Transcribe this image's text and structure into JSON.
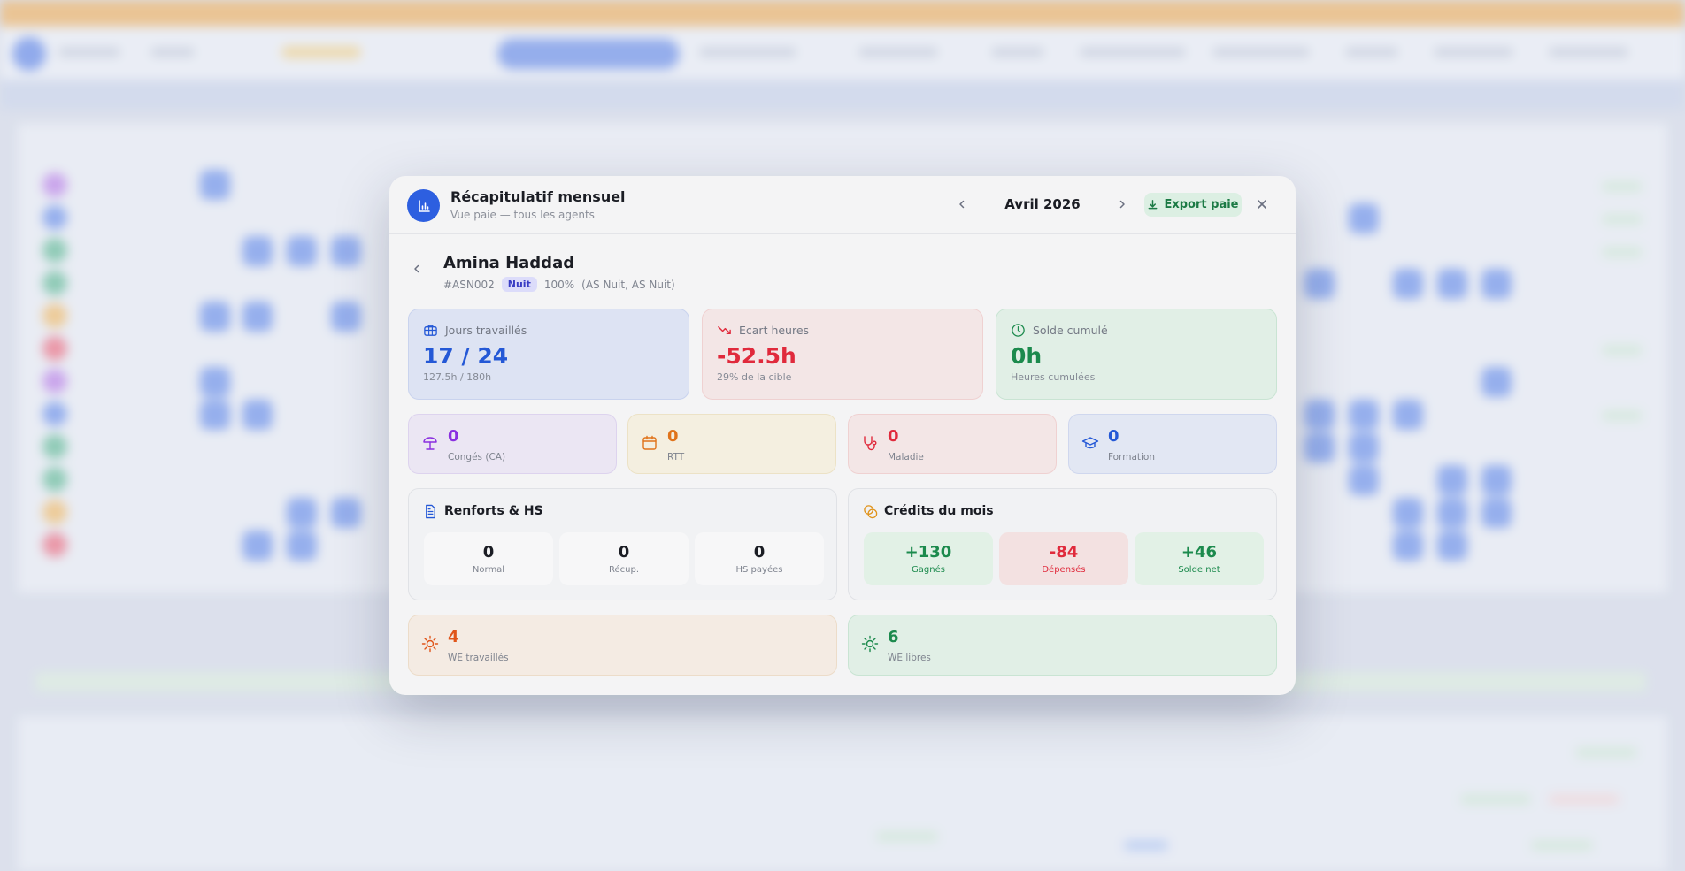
{
  "modal": {
    "title": "Récapitulatif mensuel",
    "subtitle": "Vue paie — tous les agents",
    "month": "Avril 2026",
    "export_label": "Export paie"
  },
  "agent": {
    "name": "Amina Haddad",
    "id": "#ASN002",
    "shift_badge": "Nuit",
    "rate": "100%",
    "roles": "(AS Nuit, AS Nuit)"
  },
  "stats": {
    "days": {
      "label": "Jours travaillés",
      "value": "17 / 24",
      "sub": "127.5h / 180h",
      "color": "#2458d6"
    },
    "gap": {
      "label": "Ecart heures",
      "value": "-52.5h",
      "sub": "29% de la cible",
      "color": "#e02a3c"
    },
    "balance": {
      "label": "Solde cumulé",
      "value": "0h",
      "sub": "Heures cumulées",
      "color": "#1c8a4d"
    }
  },
  "absences": [
    {
      "value": "0",
      "label": "Congés (CA)",
      "icon": "umbrella-beach-icon",
      "color": "#8a2fe0"
    },
    {
      "value": "0",
      "label": "RTT",
      "icon": "calendar-icon",
      "color": "#e0731a"
    },
    {
      "value": "0",
      "label": "Maladie",
      "icon": "stethoscope-icon",
      "color": "#e02a3c"
    },
    {
      "value": "0",
      "label": "Formation",
      "icon": "graduation-cap-icon",
      "color": "#2458d6"
    }
  ],
  "renforts": {
    "title": "Renforts & HS",
    "cells": [
      {
        "value": "0",
        "label": "Normal"
      },
      {
        "value": "0",
        "label": "Récup."
      },
      {
        "value": "0",
        "label": "HS payées"
      }
    ]
  },
  "credits": {
    "title": "Crédits du mois",
    "cells": [
      {
        "value": "+130",
        "label": "Gagnés"
      },
      {
        "value": "-84",
        "label": "Dépensés"
      },
      {
        "value": "+46",
        "label": "Solde net"
      }
    ]
  },
  "weekends": {
    "worked": {
      "value": "4",
      "label": "WE travaillés"
    },
    "free": {
      "value": "6",
      "label": "WE libres"
    }
  }
}
